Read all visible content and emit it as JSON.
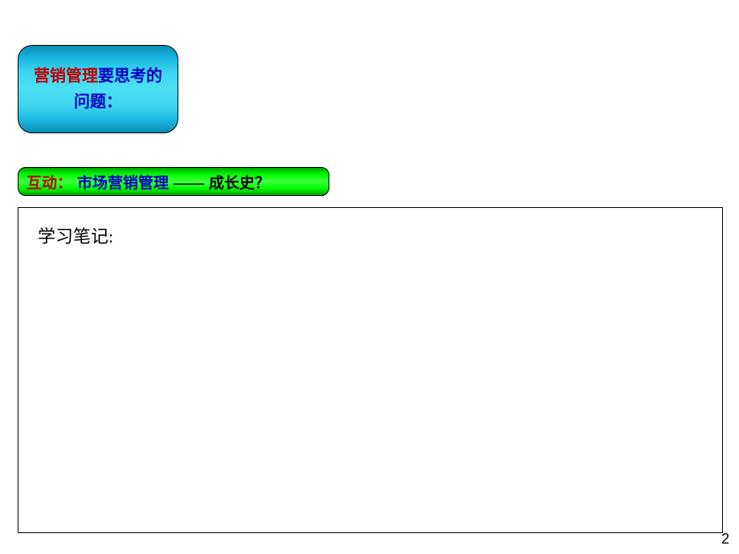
{
  "titleBox": {
    "part1": "营销管理",
    "part2": "要思考的问题："
  },
  "interactionBar": {
    "label": "互动：",
    "topicBlue": "市场营销管理",
    "dash": "——",
    "topicBlack": "成长史？"
  },
  "notes": {
    "label": "学习笔记:"
  },
  "pageNumber": "2"
}
